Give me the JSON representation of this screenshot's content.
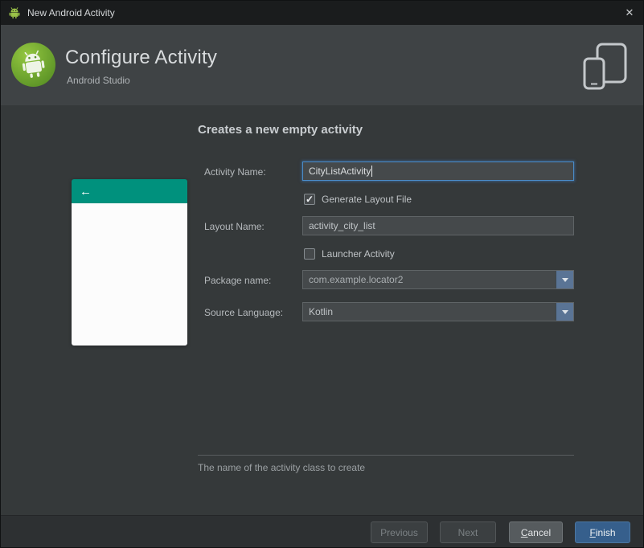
{
  "window": {
    "title": "New Android Activity",
    "close_glyph": "✕"
  },
  "header": {
    "title": "Configure Activity",
    "subtitle": "Android Studio"
  },
  "content": {
    "heading": "Creates a new empty activity",
    "hint": "The name of the activity class to create"
  },
  "preview": {
    "back_arrow": "←"
  },
  "fields": {
    "activity_name": {
      "label": "Activity Name:",
      "value": "CityListActivity"
    },
    "generate_layout": {
      "label": "Generate Layout File",
      "checked": true,
      "checkmark": "✓"
    },
    "layout_name": {
      "label": "Layout Name:",
      "value": "activity_city_list"
    },
    "launcher_activity": {
      "label": "Launcher Activity",
      "checked": false
    },
    "package_name": {
      "label": "Package name:",
      "value": "com.example.locator2"
    },
    "source_language": {
      "label": "Source Language:",
      "value": "Kotlin"
    }
  },
  "buttons": {
    "previous": "Previous",
    "next": "Next",
    "cancel_mnemonic": "C",
    "cancel_rest": "ancel",
    "finish_mnemonic": "F",
    "finish_rest": "inish"
  },
  "colors": {
    "focus_border": "#4a8cc9",
    "preview_teal": "#00917d",
    "finish_button": "#365f8c",
    "header_bg": "#3f4345"
  }
}
